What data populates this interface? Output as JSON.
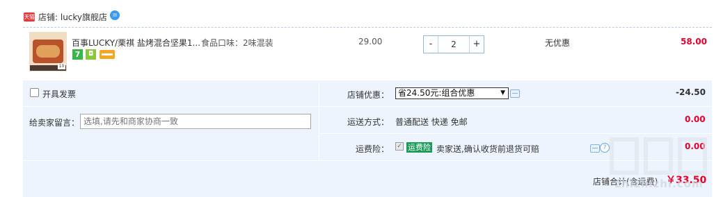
{
  "shop": {
    "badge": "天猫",
    "name": "店铺: lucky旗舰店",
    "wangwang_icon": "chat-bubble-icon"
  },
  "item": {
    "title": "百事LUCKY/栗祺 盐烤混合坚果1...",
    "flavor": "食品口味：2味混装",
    "thumb_tag": "10",
    "service_icons": [
      "7-day-return-icon",
      "quality-shield-icon",
      "credit-card-icon"
    ],
    "price": "29.00",
    "quantity": "2",
    "minus_label": "-",
    "plus_label": "+",
    "discount": "无优惠",
    "subtotal": "58.00"
  },
  "options": {
    "invoice_label": "开具发票",
    "message_label": "给卖家留言：",
    "message_placeholder": "选填,请先和商家协商一致",
    "shop_discount_label": "店铺优惠：",
    "shop_discount_selected": "省24.50元:组合优惠",
    "shop_discount_amount": "-24.50",
    "shipping_label": "运送方式：",
    "shipping_value": "普通配送 快递 免邮",
    "shipping_amount": "0.00",
    "insurance_label": "运费险：",
    "insurance_badge": "运费险",
    "insurance_desc": "卖家送,确认收货前退货可赔",
    "insurance_amount": "0.00"
  },
  "total": {
    "label": "店铺合计(含运费)",
    "value": "￥33.50"
  },
  "watermark": {
    "text": "zhizhizhi.com"
  },
  "colors": {
    "price_red": "#e4002b",
    "panel_bg": "#eef4fd",
    "insurance_green": "#1a9b59",
    "tmall_red": "#e4393c"
  }
}
